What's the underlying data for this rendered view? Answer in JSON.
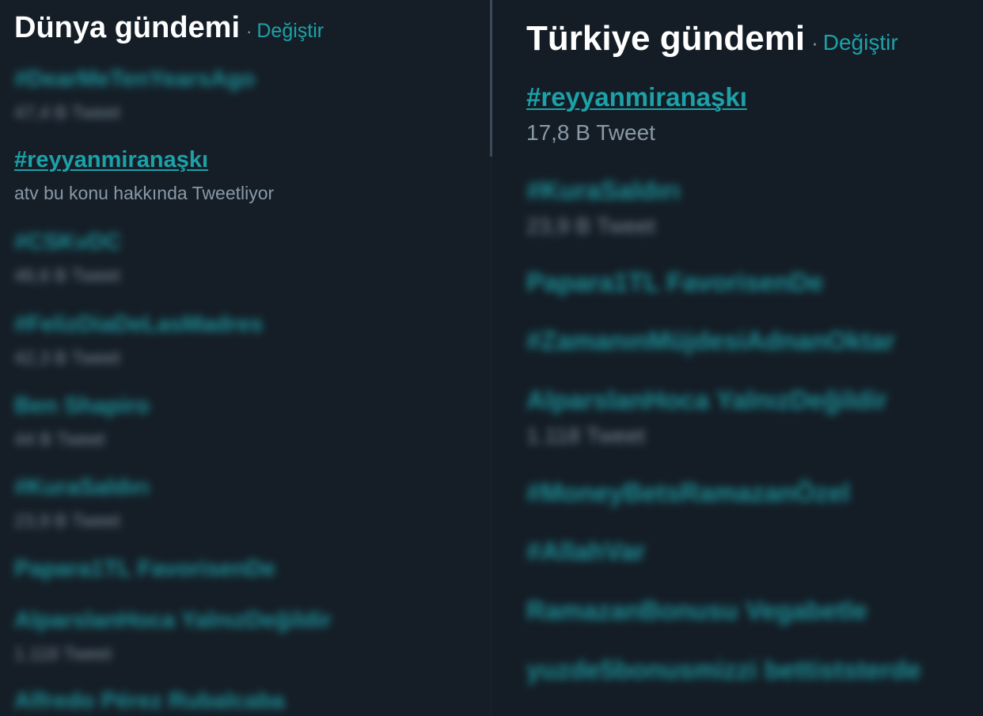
{
  "left": {
    "title": "Dünya gündemi",
    "separator": "·",
    "change_label": "Değiştir",
    "trends": [
      {
        "name": "#DearMeTenYearsAgo",
        "meta": "47,4 B Tweet",
        "blurred": true
      },
      {
        "name": "#reyyanmiranaşkı",
        "meta": "atv bu konu hakkında Tweetliyor",
        "blurred": false
      },
      {
        "name": "#CSKvDC",
        "meta": "46,6 B Tweet",
        "blurred": true
      },
      {
        "name": "#FelizDiaDeLasMadres",
        "meta": "42,3 B Tweet",
        "blurred": true
      },
      {
        "name": "Ben Shapiro",
        "meta": "44 B Tweet",
        "blurred": true
      },
      {
        "name": "#KuraSaldırı",
        "meta": "23,9 B Tweet",
        "blurred": true
      },
      {
        "name": "Papara1TL FavorisenDe",
        "meta": "",
        "blurred": true
      },
      {
        "name": "AlparslanHoca YalnızDeğildir",
        "meta": "1.118 Tweet",
        "blurred": true
      },
      {
        "name": "Alfredo Pérez Rubalcaba",
        "meta": "",
        "blurred": true
      }
    ]
  },
  "right": {
    "title": "Türkiye gündemi",
    "separator": "·",
    "change_label": "Değiştir",
    "trends": [
      {
        "name": "#reyyanmiranaşkı",
        "meta": "17,8 B Tweet",
        "blurred": false
      },
      {
        "name": "#KuraSaldırı",
        "meta": "23,9 B Tweet",
        "blurred": true
      },
      {
        "name": "Papara1TL FavorisenDe",
        "meta": "",
        "blurred": true
      },
      {
        "name": "#ZamanınMüjdesiAdnanOktar",
        "meta": "",
        "blurred": true
      },
      {
        "name": "AlparslanHoca YalnızDeğildir",
        "meta": "1.118 Tweet",
        "blurred": true
      },
      {
        "name": "#MoneyBetsRamazanÖzel",
        "meta": "",
        "blurred": true
      },
      {
        "name": "#AllahVar",
        "meta": "",
        "blurred": true
      },
      {
        "name": "RamazanBonusu Vegabetle",
        "meta": "",
        "blurred": true
      },
      {
        "name": "yuzde5bonusmizzi bettiststerde",
        "meta": "",
        "blurred": true
      }
    ]
  }
}
